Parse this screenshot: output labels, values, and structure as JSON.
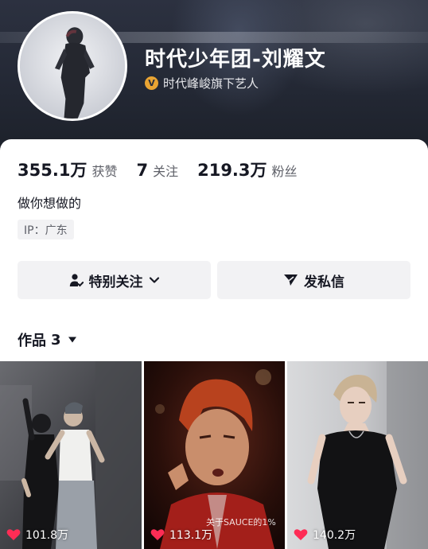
{
  "profile": {
    "nickname": "时代少年团-刘耀文",
    "verify_badge": "V",
    "verify_text": "时代峰峻旗下艺人",
    "avatar_icon": "avatar-silhouette"
  },
  "stats": [
    {
      "value": "355.1万",
      "label": "获赞"
    },
    {
      "value": "7",
      "label": "关注"
    },
    {
      "value": "219.3万",
      "label": "粉丝"
    }
  ],
  "bio": "做你想做的",
  "ip_location": "IP：广东",
  "actions": {
    "follow_label": "特别关注",
    "message_label": "发私信"
  },
  "works": {
    "tab_label": "作品",
    "count": "3",
    "items": [
      {
        "likes": "101.8万"
      },
      {
        "likes": "113.1万",
        "overlay_text": "关于SAUCE的1%"
      },
      {
        "likes": "140.2万"
      }
    ]
  },
  "colors": {
    "header_bg": "#252a37",
    "verify_badge": "#e9a433",
    "like_heart": "#fe2c55",
    "button_bg": "#f2f2f4"
  }
}
